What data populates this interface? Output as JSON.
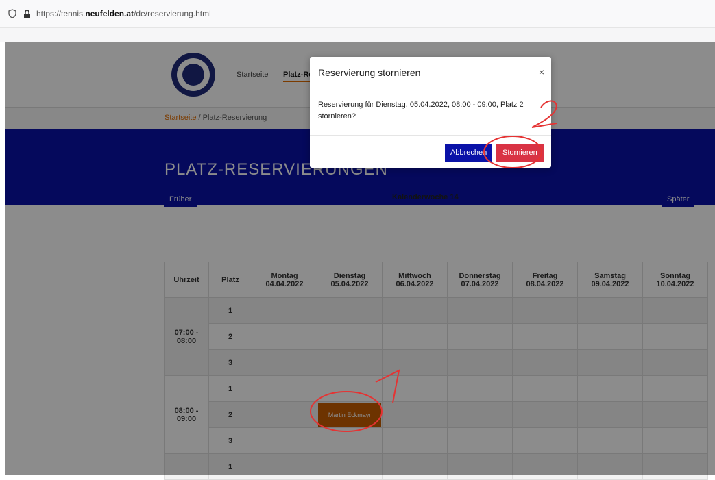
{
  "browser": {
    "url_prefix": "https://tennis.",
    "url_domain": "neufelden.at",
    "url_path": "/de/reservierung.html"
  },
  "nav": {
    "items": [
      "Startseite",
      "Platz-Re"
    ]
  },
  "breadcrumb": {
    "home": "Startseite",
    "sep": "/",
    "current": "Platz-Reservierung"
  },
  "hero": {
    "title": "PLATZ-RESERVIERUNGEN"
  },
  "calendar": {
    "prev_label": "Früher",
    "next_label": "Später",
    "week_label": "Kalenderwoche 14",
    "headers": {
      "time": "Uhrzeit",
      "court": "Platz",
      "days": [
        {
          "name": "Montag",
          "date": "04.04.2022"
        },
        {
          "name": "Dienstag",
          "date": "05.04.2022"
        },
        {
          "name": "Mittwoch",
          "date": "06.04.2022"
        },
        {
          "name": "Donnerstag",
          "date": "07.04.2022"
        },
        {
          "name": "Freitag",
          "date": "08.04.2022"
        },
        {
          "name": "Samstag",
          "date": "09.04.2022"
        },
        {
          "name": "Sonntag",
          "date": "10.04.2022"
        }
      ]
    },
    "slots": [
      {
        "time": "07:00 - 08:00",
        "courts": [
          "1",
          "2",
          "3"
        ]
      },
      {
        "time": "08:00 - 09:00",
        "courts": [
          "1",
          "2",
          "3"
        ]
      },
      {
        "time": "",
        "courts": [
          "1"
        ]
      }
    ],
    "reservation": {
      "label": "Martin Eckmayr"
    }
  },
  "modal": {
    "title": "Reservierung stornieren",
    "close": "×",
    "body": "Reservierung für Dienstag, 05.04.2022, 08:00 - 09:00, Platz 2 stornieren?",
    "cancel": "Abbrechen",
    "confirm": "Stornieren"
  },
  "annotations": {
    "n1": "1",
    "n2": "2"
  }
}
